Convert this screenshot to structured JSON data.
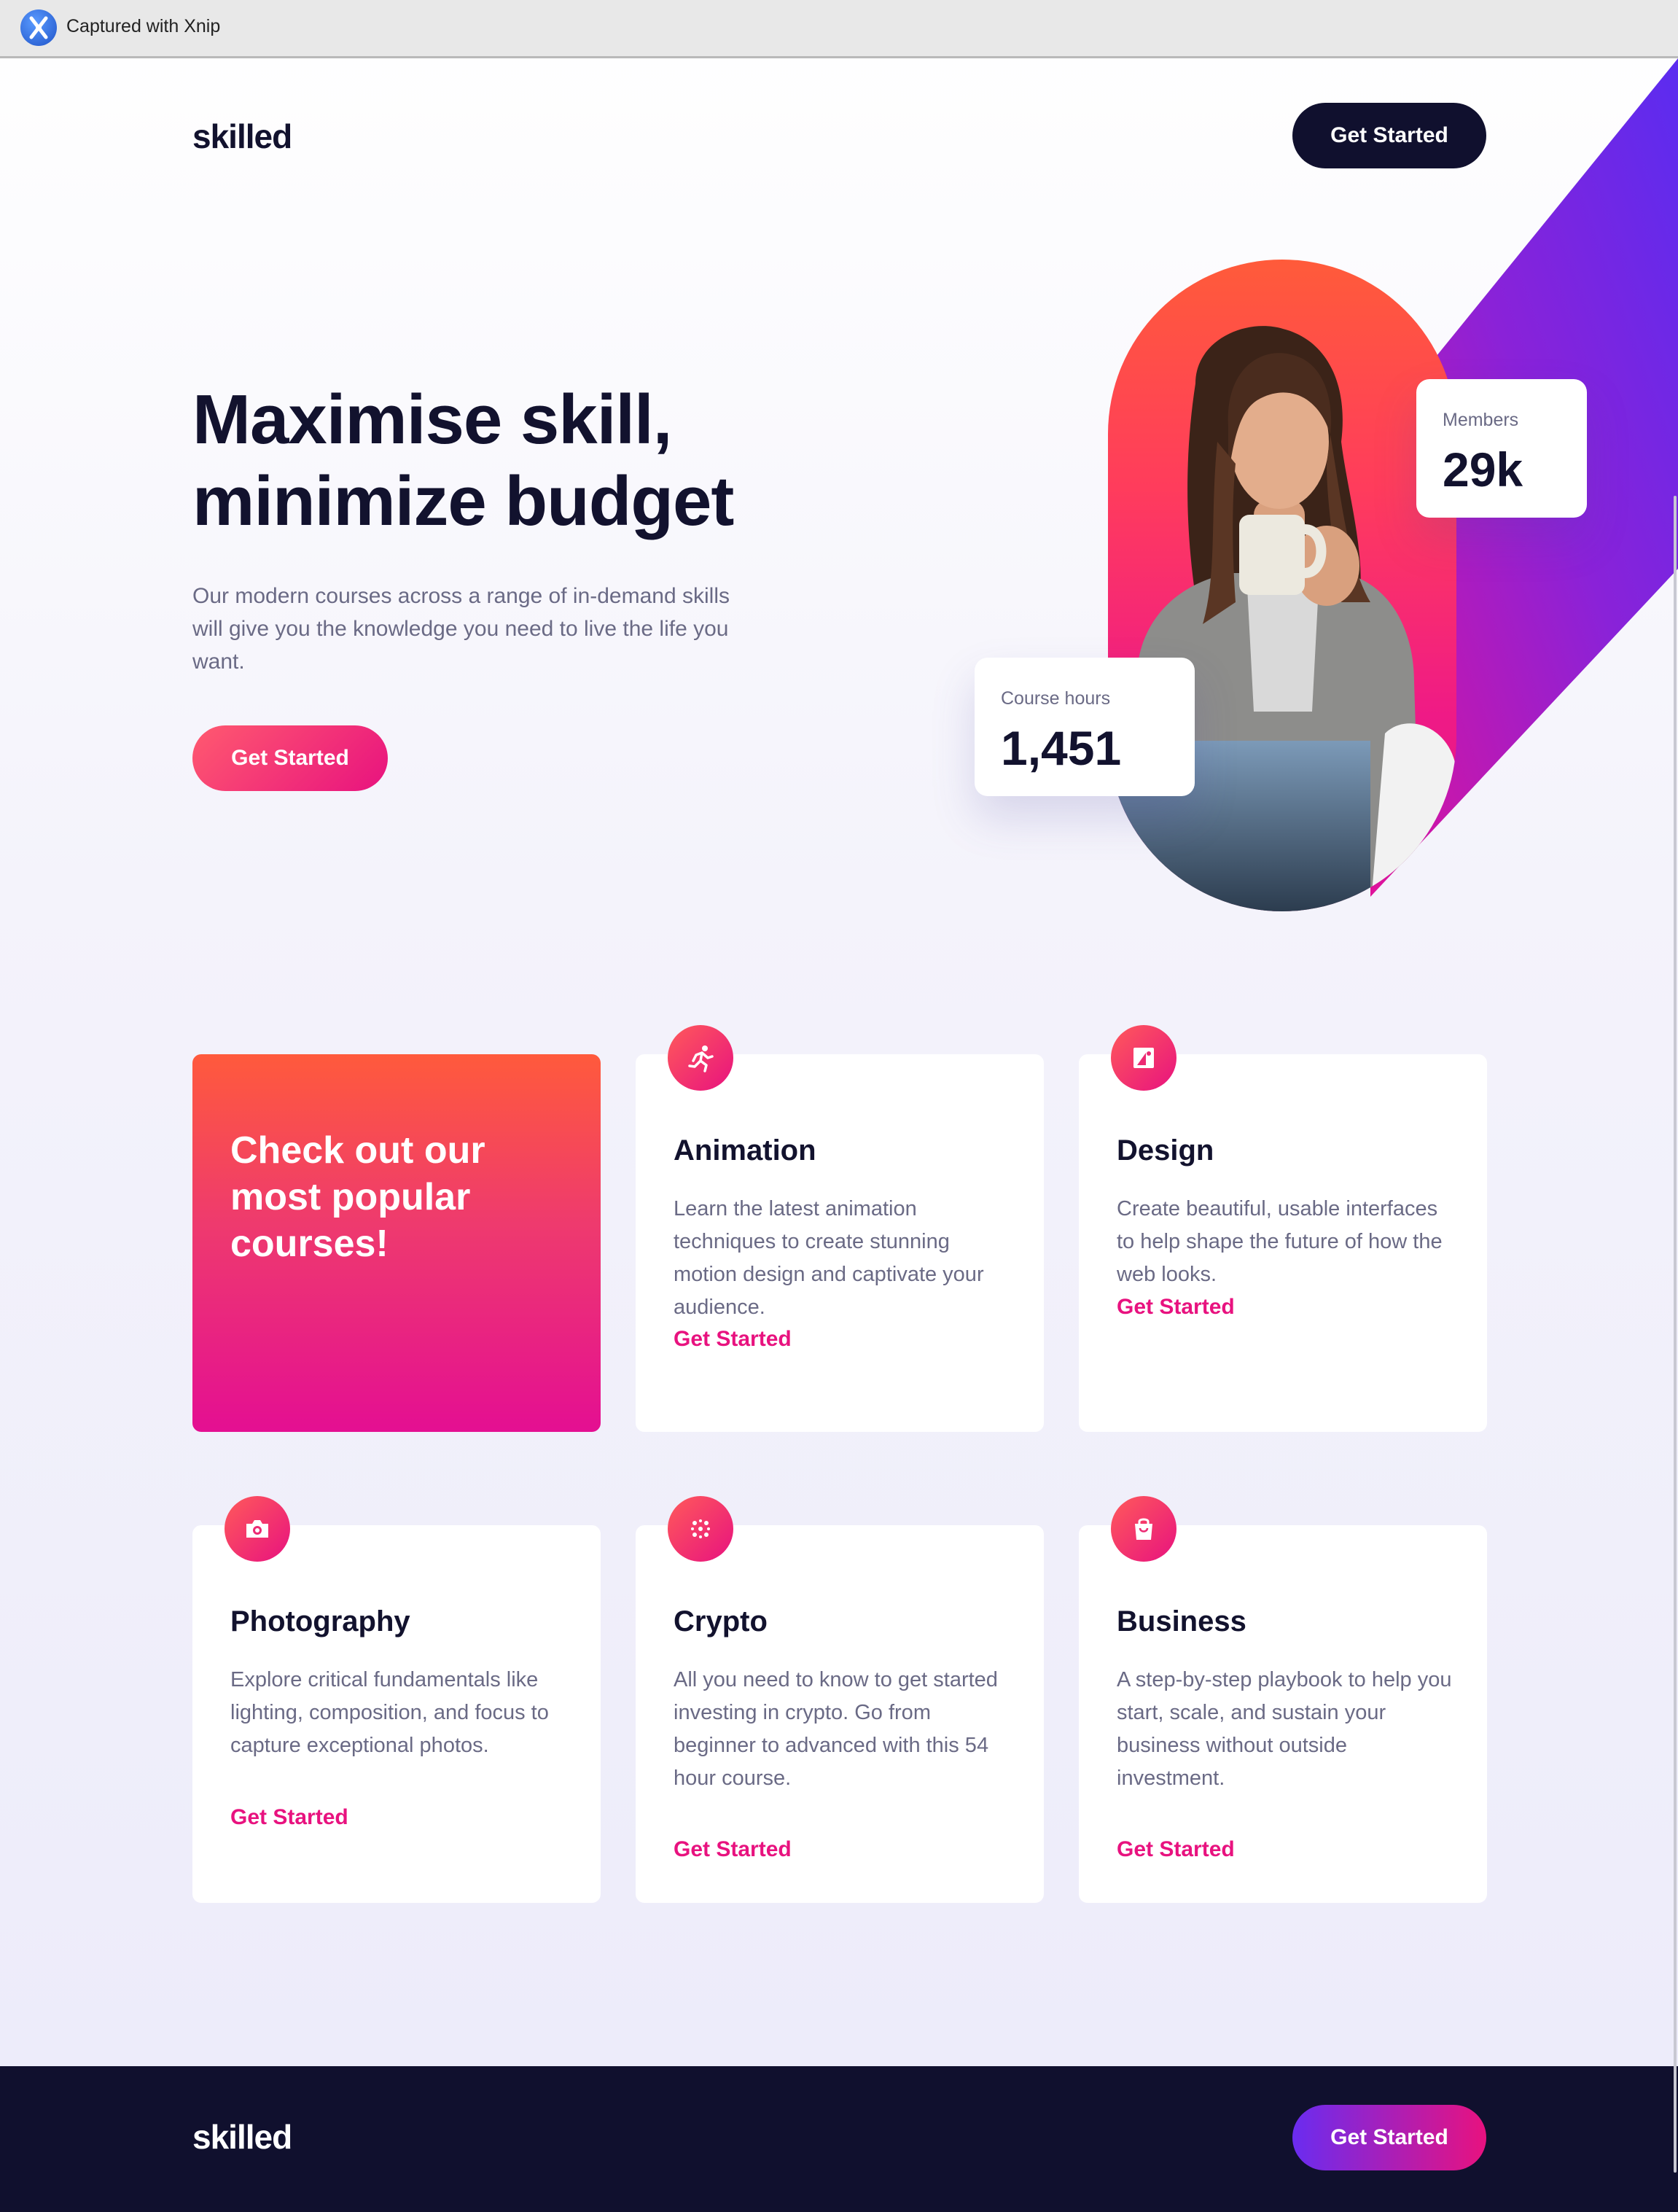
{
  "capture": {
    "label": "Captured with Xnip",
    "icon": "xnip-logo-icon"
  },
  "header": {
    "logo": "skilled",
    "cta_label": "Get Started"
  },
  "hero": {
    "title_line1": "Maximise skill,",
    "title_line2": "minimize budget",
    "description": "Our modern courses across a range of in-demand skills will give you the knowledge you need to live the life you want.",
    "cta_label": "Get Started",
    "stats": {
      "members_label": "Members",
      "members_value": "29k",
      "hours_label": "Course hours",
      "hours_value": "1,451"
    }
  },
  "courses": {
    "feature_title": "Check out our most popular courses!",
    "items": [
      {
        "title": "Animation",
        "description": "Learn the latest animation techniques to create stunning motion design and captivate your audience.",
        "link": "Get Started",
        "icon": "running-figure-icon"
      },
      {
        "title": "Design",
        "description": "Create beautiful, usable interfaces to help shape the future of how the web looks.",
        "link": "Get Started",
        "icon": "design-shapes-icon"
      },
      {
        "title": "Photography",
        "description": "Explore critical fundamentals like lighting, composition, and focus to capture exceptional photos.",
        "link": "Get Started",
        "icon": "camera-icon"
      },
      {
        "title": "Crypto",
        "description": "All you need to know to get started investing in crypto. Go from beginner to advanced with this 54 hour course.",
        "link": "Get Started",
        "icon": "crypto-dots-icon"
      },
      {
        "title": "Business",
        "description": "A step-by-step playbook to help you start, scale, and sustain your business without outside investment.",
        "link": "Get Started",
        "icon": "shopping-bag-icon"
      }
    ]
  },
  "footer": {
    "logo": "skilled",
    "cta_label": "Get Started"
  },
  "colors": {
    "navy": "#12122e",
    "pink": "#e8127f",
    "orange": "#ff5a3c",
    "purple": "#6a2cf0"
  }
}
